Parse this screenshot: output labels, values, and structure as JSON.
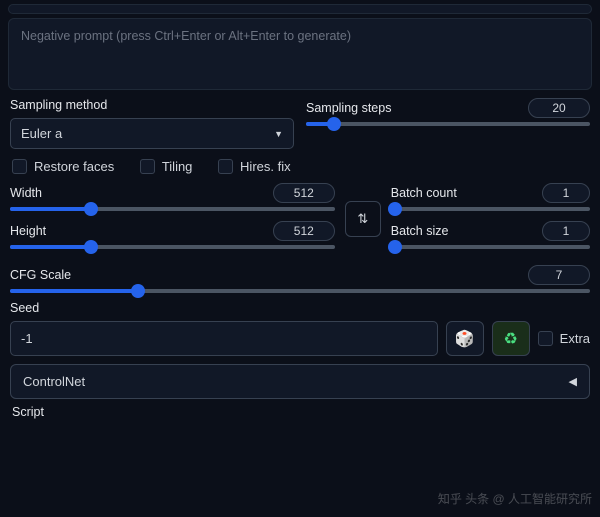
{
  "negative_prompt": {
    "placeholder": "Negative prompt (press Ctrl+Enter or Alt+Enter to generate)"
  },
  "sampling_method": {
    "label": "Sampling method",
    "value": "Euler a"
  },
  "sampling_steps": {
    "label": "Sampling steps",
    "value": "20",
    "fill_pct": 10
  },
  "checks": {
    "restore_faces": "Restore faces",
    "tiling": "Tiling",
    "hires_fix": "Hires. fix"
  },
  "width": {
    "label": "Width",
    "value": "512",
    "fill_pct": 25
  },
  "height": {
    "label": "Height",
    "value": "512",
    "fill_pct": 25
  },
  "batch_count": {
    "label": "Batch count",
    "value": "1",
    "fill_pct": 2
  },
  "batch_size": {
    "label": "Batch size",
    "value": "1",
    "fill_pct": 2
  },
  "cfg_scale": {
    "label": "CFG Scale",
    "value": "7",
    "fill_pct": 22
  },
  "seed": {
    "label": "Seed",
    "value": "-1",
    "extra": "Extra"
  },
  "controlnet": {
    "label": "ControlNet"
  },
  "script": {
    "label": "Script"
  },
  "swap_icon": "⇅",
  "dice_icon": "🎲",
  "recycle_icon": "♻",
  "caret_down": "▼",
  "caret_left": "◀",
  "watermark": "知乎 头条 @ 人工智能研究所"
}
